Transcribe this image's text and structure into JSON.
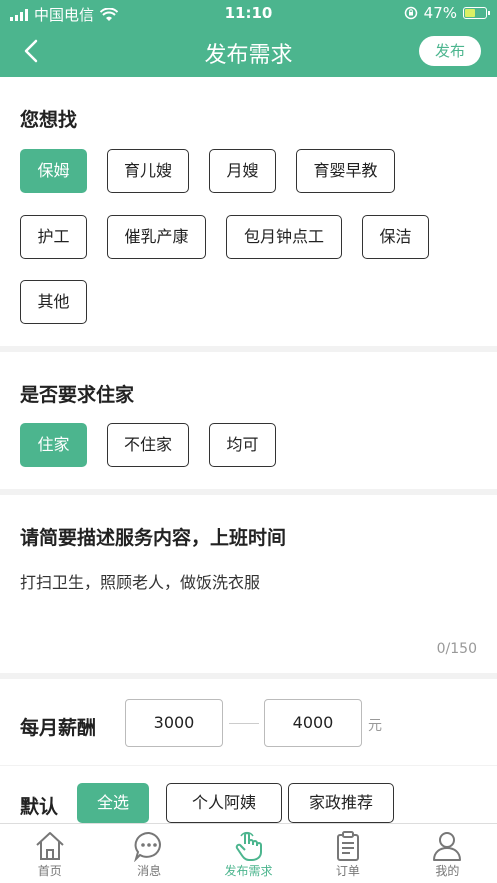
{
  "status_bar": {
    "carrier": "中国电信",
    "time": "11:10",
    "battery": "47%",
    "battery_level": 0.47
  },
  "header": {
    "title": "发布需求",
    "publish_label": "发布"
  },
  "want": {
    "title": "您想找",
    "options": [
      "保姆",
      "育儿嫂",
      "月嫂",
      "育婴早教",
      "护工",
      "催乳产康",
      "包月钟点工",
      "保洁",
      "其他"
    ],
    "selected": "保姆"
  },
  "live_in": {
    "title": "是否要求住家",
    "options": [
      "住家",
      "不住家",
      "均可"
    ],
    "selected": "住家"
  },
  "description": {
    "title": "请简要描述服务内容，上班时间",
    "text": "打扫卫生，照顾老人，做饭洗衣服",
    "count": "0/150"
  },
  "salary": {
    "label": "每月薪酬",
    "min": "3000",
    "max": "4000",
    "unit": "元"
  },
  "default_filter": {
    "label": "默认",
    "options": [
      "全选",
      "个人阿姨",
      "家政推荐"
    ],
    "selected": "全选"
  },
  "tabbar": {
    "items": [
      "首页",
      "消息",
      "发布需求",
      "订单",
      "我的"
    ],
    "active": "发布需求"
  },
  "colors": {
    "accent": "#4cb58e",
    "text": "#222222",
    "muted": "#999999"
  }
}
